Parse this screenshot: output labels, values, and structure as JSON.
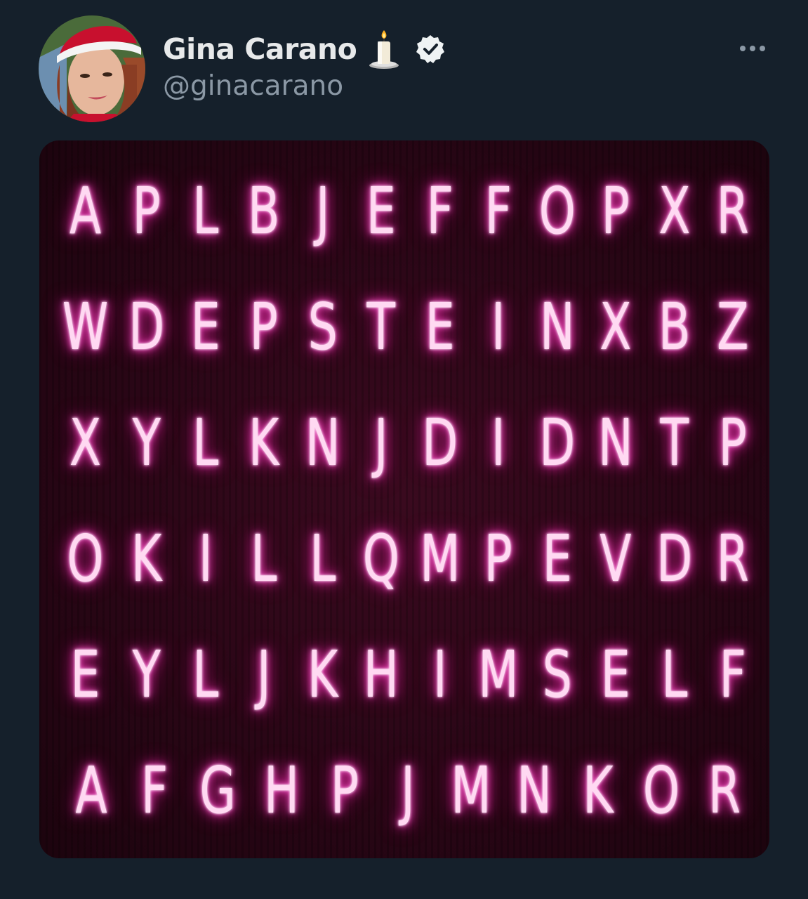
{
  "tweet": {
    "display_name": "Gina Carano",
    "handle": "@ginacarano",
    "name_emoji": "candle-icon",
    "verified": true
  },
  "media": {
    "type": "neon letter grid image",
    "rows": [
      [
        "A",
        "P",
        "L",
        "B",
        "J",
        "E",
        "F",
        "F",
        "O",
        "P",
        "X",
        "R"
      ],
      [
        "W",
        "D",
        "E",
        "P",
        "S",
        "T",
        "E",
        "I",
        "N",
        "X",
        "B",
        "Z"
      ],
      [
        "X",
        "Y",
        "L",
        "K",
        "N",
        "J",
        "D",
        "I",
        "D",
        "N",
        "T",
        "P"
      ],
      [
        "O",
        "K",
        "I",
        "L",
        "L",
        "Q",
        "M",
        "P",
        "E",
        "V",
        "D",
        "R"
      ],
      [
        "E",
        "Y",
        "L",
        "J",
        "K",
        "H",
        "I",
        "M",
        "S",
        "E",
        "L",
        "F"
      ],
      [
        "A",
        "F",
        "G",
        "H",
        "P",
        "J",
        "M",
        "N",
        "K",
        "O",
        "R"
      ]
    ],
    "glow_color": "#ff2fb8",
    "background_color": "#2a0616"
  },
  "colors": {
    "background": "#15202b",
    "name_text": "#e7e9ea",
    "secondary_text": "#8b98a5"
  }
}
